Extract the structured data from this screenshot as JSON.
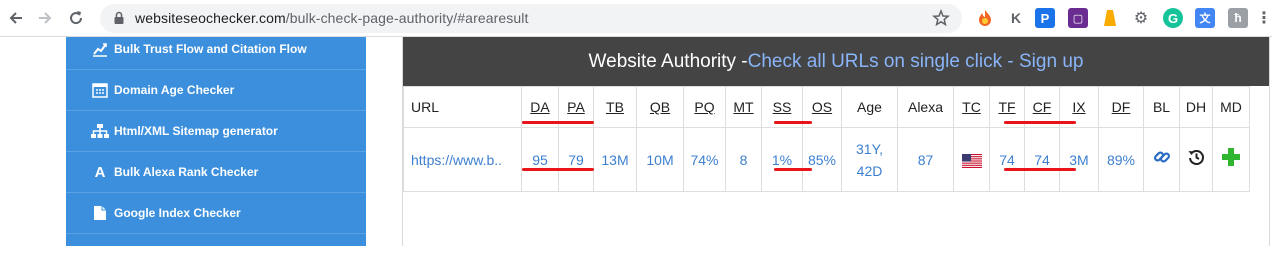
{
  "browser": {
    "url_host": "websiteseochecker.com",
    "url_path": "/bulk-check-page-authority/#arearesult"
  },
  "sidebar": {
    "items": [
      {
        "label": "Bulk Trust Flow and Citation Flow",
        "icon": "trend-chart-icon"
      },
      {
        "label": "Domain Age Checker",
        "icon": "calendar-icon"
      },
      {
        "label": "Html/XML Sitemap generator",
        "icon": "sitemap-icon"
      },
      {
        "label": "Bulk Alexa Rank Checker",
        "icon": "letter-a-icon"
      },
      {
        "label": "Google Index Checker",
        "icon": "document-icon"
      }
    ]
  },
  "panel": {
    "title": "Website Authority - ",
    "title_link": "Check all URLs on single click - Sign up"
  },
  "table": {
    "headers": [
      "URL",
      "DA",
      "PA",
      "TB",
      "QB",
      "PQ",
      "MT",
      "SS",
      "OS",
      "Age",
      "Alexa",
      "TC",
      "TF",
      "CF",
      "IX",
      "DF",
      "BL",
      "DH",
      "MD"
    ],
    "row": {
      "url": "https://www.b..",
      "da": "95",
      "pa": "79",
      "tb": "13M",
      "qb": "10M",
      "pq": "74%",
      "mt": "8",
      "ss": "1%",
      "os": "85%",
      "age_1": "31Y,",
      "age_2": "42D",
      "alexa": "87",
      "tc": "us-flag-icon",
      "tf": "74",
      "cf": "74",
      "ix": "3M",
      "df": "89%",
      "bl": "link-icon",
      "dh": "history-icon",
      "md": "plus-icon"
    }
  },
  "colors": {
    "sidebar_bg": "#3c8fdc",
    "header_bg": "#444444",
    "link": "#3d7fcf",
    "highlight": "#e8141a"
  }
}
